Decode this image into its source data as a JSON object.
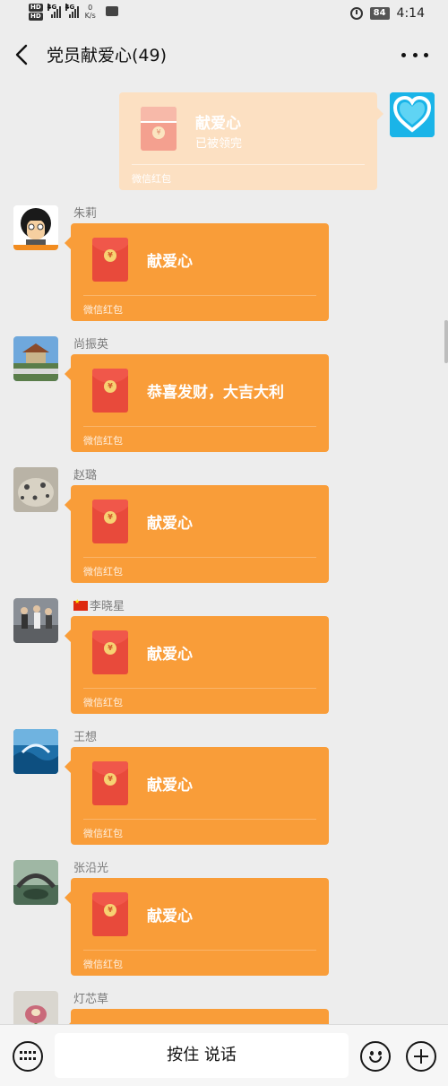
{
  "status_bar": {
    "hd_labels": [
      "HD",
      "HD"
    ],
    "signal_labels": [
      "4G",
      "4G"
    ],
    "net_speed_value": "0",
    "net_speed_unit": "K/s",
    "battery": "84",
    "time": "4:14"
  },
  "header": {
    "title": "党员献爱心(49)"
  },
  "own_message": {
    "title": "献爱心",
    "status": "已被领完",
    "footer": "微信红包"
  },
  "messages": [
    {
      "sender": "朱莉",
      "title": "献爱心",
      "footer": "微信红包"
    },
    {
      "sender": "尚振英",
      "title": "恭喜发财，大吉大利",
      "footer": "微信红包"
    },
    {
      "sender": "赵璐",
      "title": "献爱心",
      "footer": "微信红包"
    },
    {
      "sender": "李晓星",
      "title": "献爱心",
      "footer": "微信红包"
    },
    {
      "sender": "王想",
      "title": "献爱心",
      "footer": "微信红包"
    },
    {
      "sender": "张沿光",
      "title": "献爱心",
      "footer": "微信红包"
    },
    {
      "sender": "灯芯草",
      "title": "",
      "footer": ""
    }
  ],
  "input_bar": {
    "voice_label": "按住 说话"
  },
  "coin_glyph": "¥",
  "colors": {
    "packet": "#f99d39",
    "packet_opened": "#fce0c2",
    "background": "#ededed"
  }
}
